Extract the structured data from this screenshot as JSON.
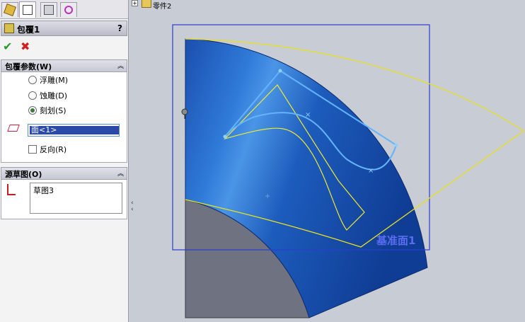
{
  "tabs": [
    {
      "icon": "feature-manager-icon",
      "active": false
    },
    {
      "icon": "property-manager-icon",
      "active": true
    },
    {
      "icon": "configuration-manager-icon",
      "active": false
    },
    {
      "icon": "dimxpert-icon",
      "active": false
    }
  ],
  "feature": {
    "title": "包覆1",
    "help": "?"
  },
  "wrap_params": {
    "header": "包覆参数(W)",
    "options": [
      {
        "label": "浮雕(M)",
        "checked": false
      },
      {
        "label": "蚀雕(D)",
        "checked": false
      },
      {
        "label": "刻划(S)",
        "checked": true
      }
    ],
    "face_value": "面<1>",
    "reverse_label": "反向(R)",
    "reverse_checked": false
  },
  "source_sketch": {
    "header": "源草图(O)",
    "item": "草图3"
  },
  "tree": {
    "part_label": "零件2"
  },
  "viewport": {
    "plane_label": "基准面1"
  }
}
